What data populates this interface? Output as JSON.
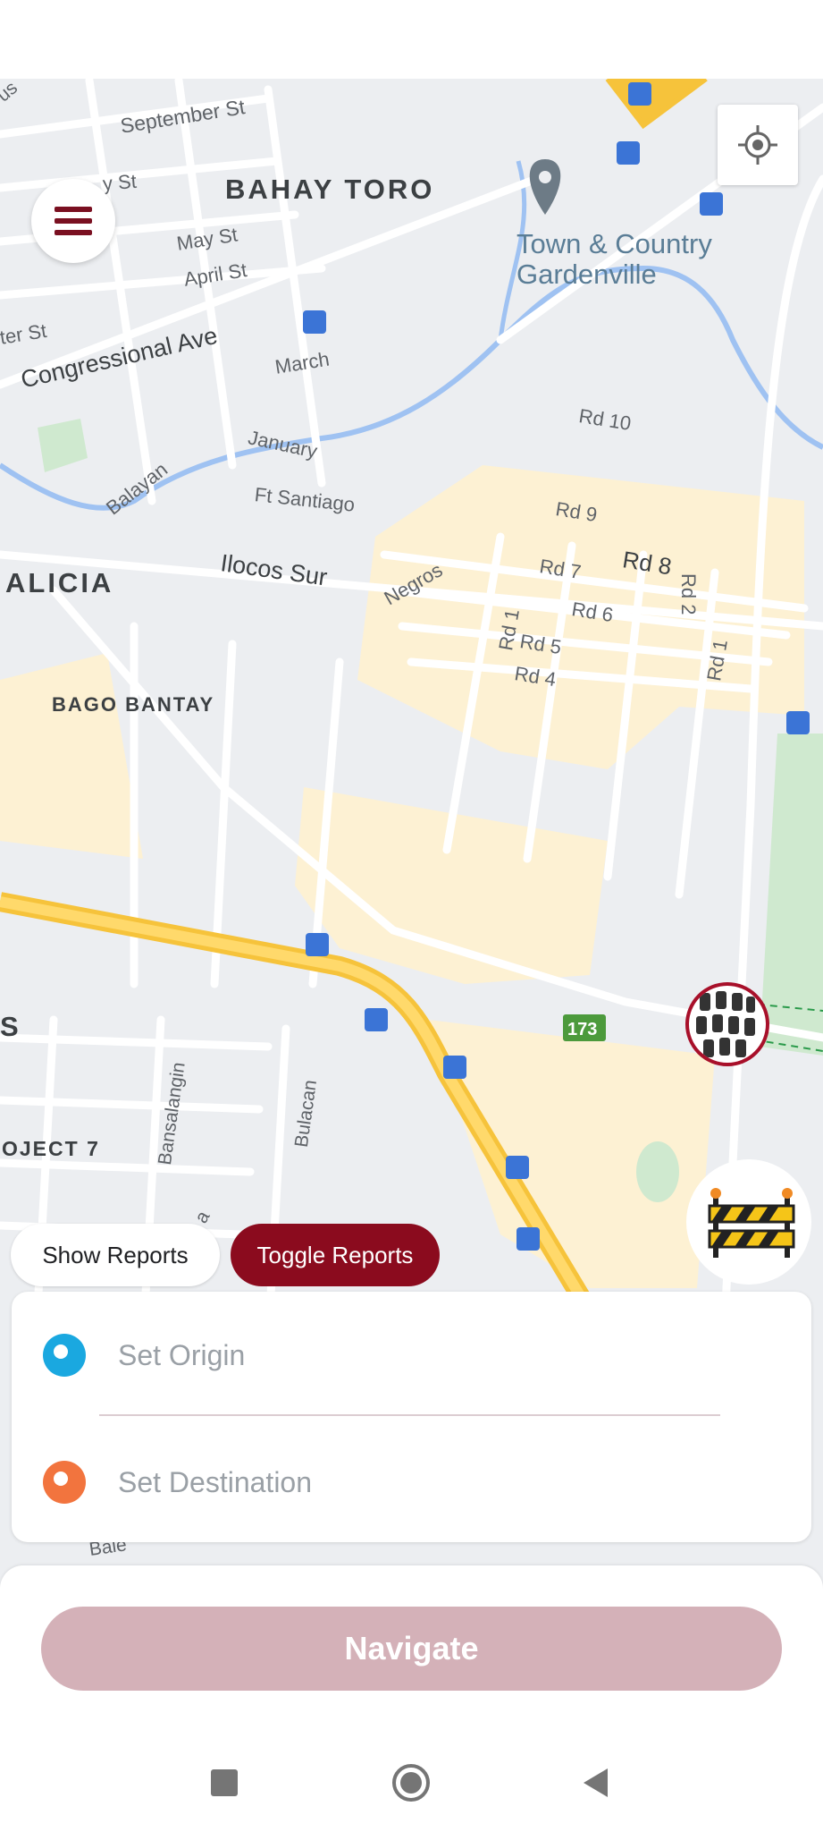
{
  "map": {
    "area_labels": [
      "BAHAY TORO",
      "ALICIA",
      "BAGO BANTAY",
      "OJECT 7",
      "S"
    ],
    "poi": {
      "name": "Town & Country\nGardenville"
    },
    "streets": {
      "september_st": "September St",
      "st": "y St",
      "may_st": "May St",
      "april_st": "April St",
      "ter_st": "ter St",
      "congressional_ave": "Congressional Ave",
      "march": "March",
      "january": "January",
      "balayan": "Balayan",
      "ft_santiago": "Ft Santiago",
      "ilocos_sur": "Ilocos Sur",
      "negros": "Negros",
      "rd10": "Rd 10",
      "rd9": "Rd 9",
      "rd2": "Rd 2",
      "rd8": "Rd 8",
      "rd7": "Rd 7",
      "rd1_a": "Rd 1",
      "rd6": "Rd 6",
      "rd5": "Rd 5",
      "rd4": "Rd 4",
      "rd1_b": "Rd 1",
      "bansalangin": "Bansalangin",
      "bulacan": "Bulacan",
      "bale": "Bale",
      "a": "a",
      "us": "us"
    },
    "route_shield": "173"
  },
  "controls": {
    "menu_icon": "hamburger-menu-icon",
    "locate_icon": "my-location-icon"
  },
  "reports": {
    "show_label": "Show Reports",
    "toggle_label": "Toggle Reports"
  },
  "route": {
    "origin_placeholder": "Set Origin",
    "destination_placeholder": "Set Destination",
    "origin_color": "#1aa8e0",
    "destination_color": "#f2743e"
  },
  "navigate": {
    "label": "Navigate"
  },
  "colors": {
    "accent": "#8b0b1e",
    "navigate_disabled": "#d4b1b8"
  }
}
